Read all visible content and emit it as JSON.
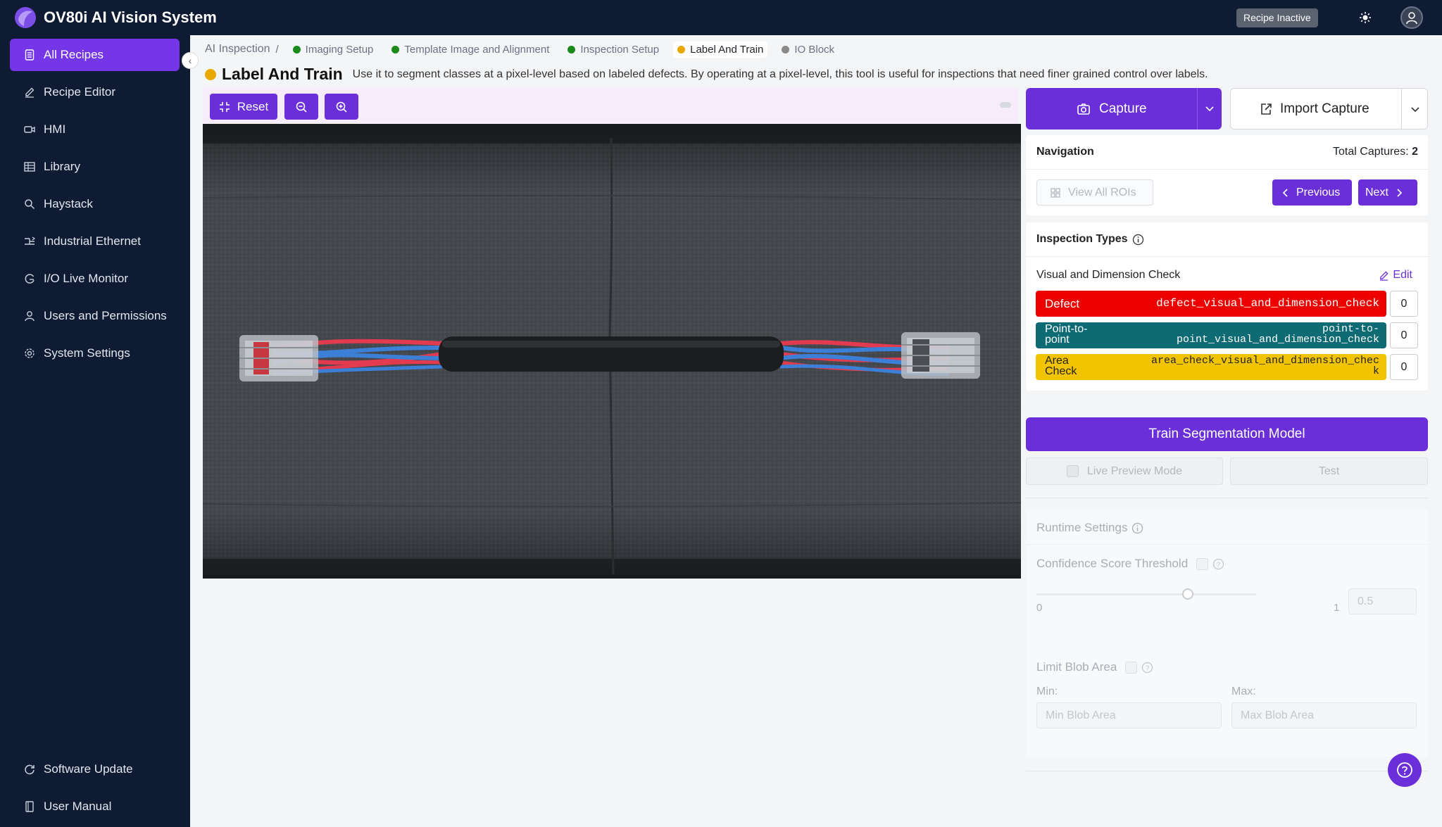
{
  "app": {
    "title": "OV80i AI Vision System",
    "status_badge": "Recipe Inactive"
  },
  "sidebar": {
    "items": [
      {
        "label": "All Recipes",
        "icon": "document-icon",
        "active": true
      },
      {
        "label": "Recipe Editor",
        "icon": "pencil-icon"
      },
      {
        "label": "HMI",
        "icon": "video-icon"
      },
      {
        "label": "Library",
        "icon": "grid-icon"
      },
      {
        "label": "Haystack",
        "icon": "search-icon"
      },
      {
        "label": "Industrial Ethernet",
        "icon": "network-icon"
      },
      {
        "label": "I/O Live Monitor",
        "icon": "monitor-icon"
      },
      {
        "label": "Users and Permissions",
        "icon": "user-icon"
      },
      {
        "label": "System Settings",
        "icon": "gear-icon"
      }
    ],
    "footer": [
      {
        "label": "Software Update",
        "icon": "refresh-icon"
      },
      {
        "label": "User Manual",
        "icon": "book-icon"
      }
    ]
  },
  "breadcrumb": {
    "root": "AI Inspection",
    "separator": "/",
    "steps": [
      {
        "label": "Imaging Setup",
        "color": "#1a8a1a"
      },
      {
        "label": "Template Image and Alignment",
        "color": "#1a8a1a"
      },
      {
        "label": "Inspection Setup",
        "color": "#1a8a1a"
      },
      {
        "label": "Label And Train",
        "color": "#e8a800",
        "active": true
      },
      {
        "label": "IO Block",
        "color": "#8a8a8a"
      }
    ]
  },
  "header": {
    "title": "Label And Train",
    "status_color": "#e8a800",
    "description": "Use it to segment classes at a pixel-level based on labeled defects. By operating at a pixel-level, this tool is useful for inspections that need finer grained control over labels."
  },
  "toolbar": {
    "reset_label": "Reset"
  },
  "capture": {
    "capture_label": "Capture",
    "import_label": "Import Capture"
  },
  "navigation": {
    "title": "Navigation",
    "total_label": "Total Captures:",
    "total_value": "2",
    "view_all_label": "View All ROIs",
    "previous_label": "Previous",
    "next_label": "Next"
  },
  "inspection_types": {
    "title": "Inspection Types",
    "group_title": "Visual and Dimension Check",
    "edit_label": "Edit",
    "rows": [
      {
        "name": "Defect",
        "key": "defect_visual_and_dimension_check",
        "count": "0",
        "color": "#ee0000"
      },
      {
        "name_line1": "Point-to-",
        "name_line2": "point",
        "key_line1": "point-to-",
        "key_line2": "point_visual_and_dimension_check",
        "count": "0",
        "color": "#0e6b73"
      },
      {
        "name_line1": "Area",
        "name_line2": "Check",
        "key_line1": "area_check_visual_and_dimension_chec",
        "key_line2": "k",
        "count": "0",
        "color": "#f2c400"
      }
    ]
  },
  "train": {
    "train_label": "Train Segmentation Model",
    "live_preview_label": "Live Preview Mode",
    "test_label": "Test"
  },
  "runtime": {
    "title": "Runtime Settings",
    "confidence_label": "Confidence Score Threshold",
    "slider_min": "0",
    "slider_max": "1",
    "slider_value": "0.5",
    "limit_blob_label": "Limit Blob Area",
    "min_label": "Min:",
    "max_label": "Max:",
    "min_placeholder": "Min Blob Area",
    "max_placeholder": "Max Blob Area"
  }
}
